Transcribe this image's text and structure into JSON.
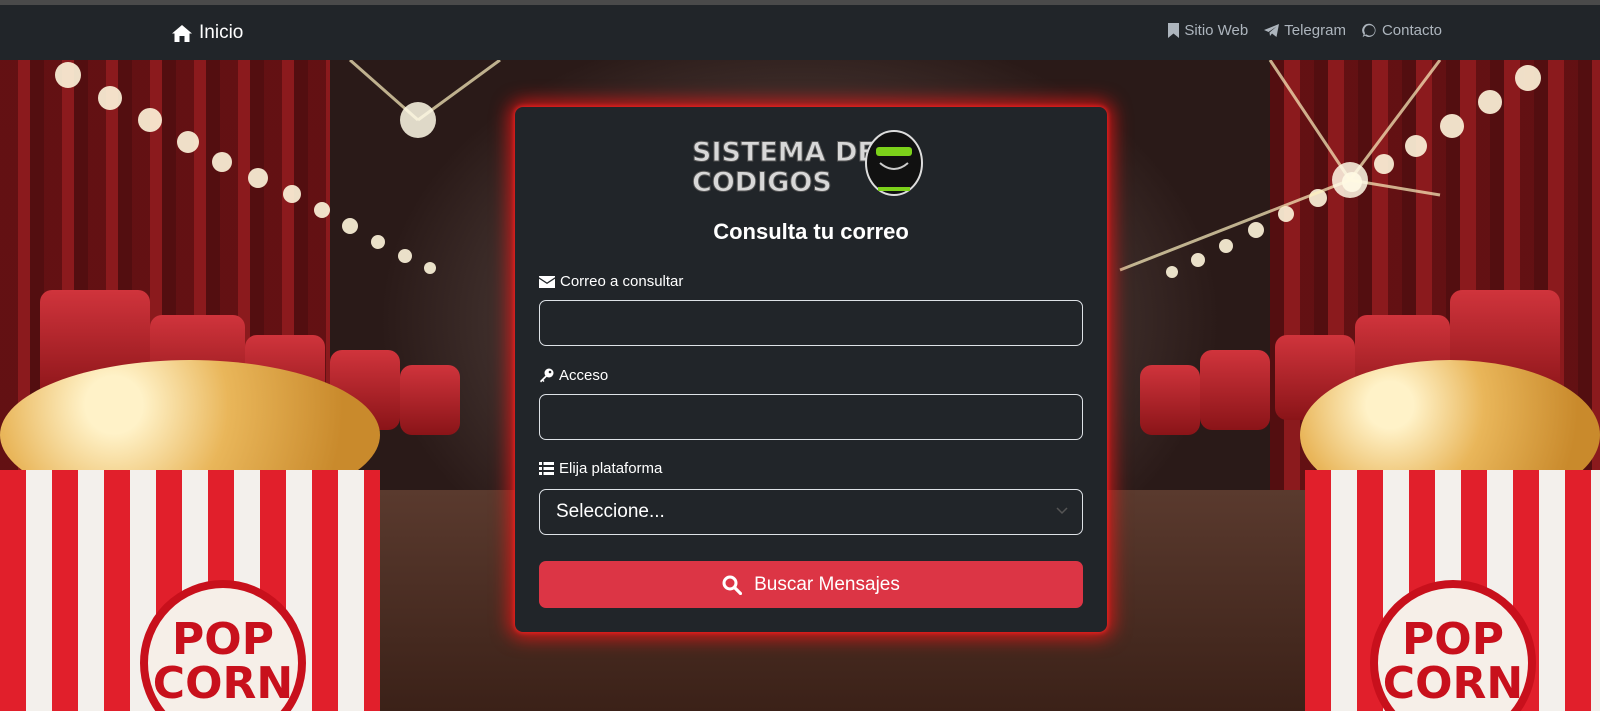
{
  "navbar": {
    "brand_label": "Inicio",
    "links": [
      {
        "label": "Sitio Web",
        "icon": "bookmark-icon"
      },
      {
        "label": "Telegram",
        "icon": "telegram-icon"
      },
      {
        "label": "Contacto",
        "icon": "whatsapp-icon"
      }
    ]
  },
  "card": {
    "logo_text": "SISTEMA DE CODIGOS",
    "title": "Consulta tu correo",
    "email_label": "Correo a consultar",
    "email_value": "",
    "access_label": "Acceso",
    "access_value": "",
    "platform_label": "Elija plataforma",
    "platform_selected": "Seleccione...",
    "submit_label": "Buscar Mensajes"
  },
  "background": {
    "popcorn_text_left": "POP CORN",
    "popcorn_text_right": "POP CORN"
  },
  "colors": {
    "navbar_bg": "#212529",
    "card_bg": "#212529",
    "card_glow": "#ff1414",
    "button_bg": "#dc3545",
    "text_muted": "#adb5bd"
  }
}
